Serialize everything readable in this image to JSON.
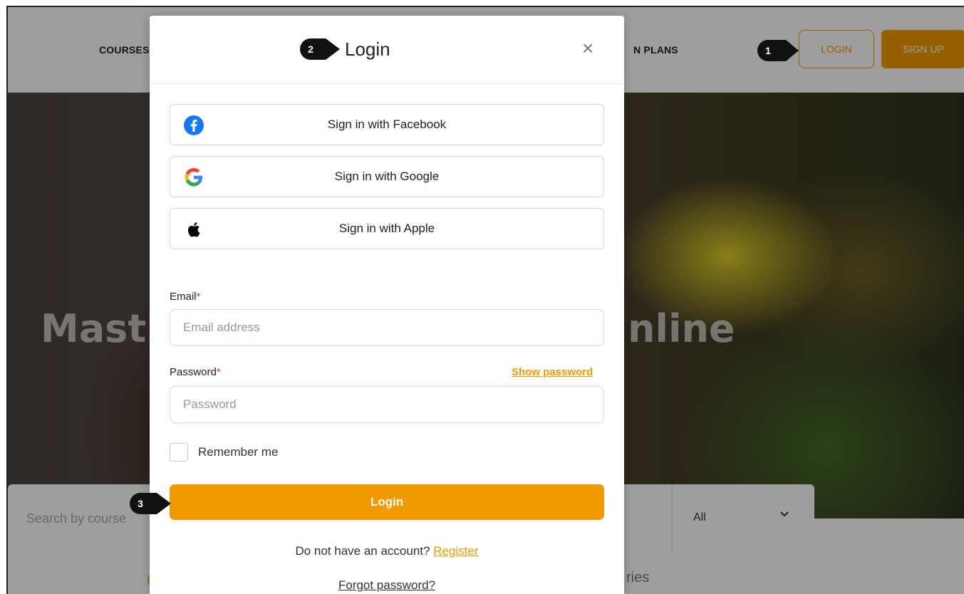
{
  "nav": {
    "courses": "COURSES",
    "plans": "N PLANS",
    "login": "LOGIN",
    "signup": "SIGN UP"
  },
  "hero": {
    "title_left": "Mast",
    "title_right": "nline"
  },
  "search": {
    "placeholder": "Search by course",
    "select_value": "All",
    "bottom_text": "ries"
  },
  "modal": {
    "title": "Login",
    "close": "×",
    "social": {
      "facebook": "Sign in with Facebook",
      "google": "Sign in with Google",
      "apple": "Sign in with Apple"
    },
    "email": {
      "label": "Email",
      "required": "*",
      "placeholder": "Email address"
    },
    "password": {
      "label": "Password",
      "required": "*",
      "placeholder": "Password",
      "show": "Show password"
    },
    "remember": "Remember me",
    "submit": "Login",
    "register_prompt": "Do not have an account?",
    "register_link": "Register",
    "forgot": "Forgot password?"
  },
  "annotations": [
    "1",
    "2",
    "3"
  ],
  "colors": {
    "accent": "#f29a00",
    "facebook": "#1877f2",
    "required": "#e53935"
  }
}
